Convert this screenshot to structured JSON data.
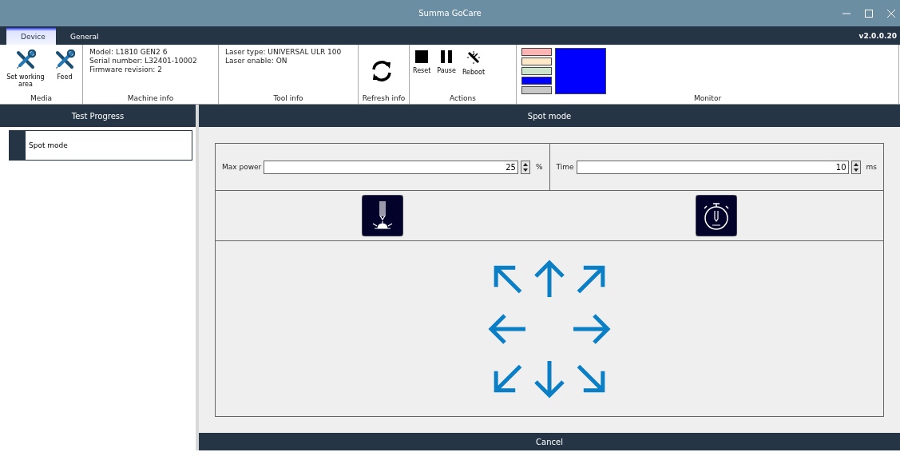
{
  "window": {
    "title": "Summa GoCare",
    "version": "v2.0.0.20"
  },
  "tabs": [
    {
      "label": "Device",
      "selected": true
    },
    {
      "label": "General",
      "selected": false
    }
  ],
  "ribbon": [
    {
      "kind": "buttons",
      "label": "Media",
      "buttons": [
        {
          "label": "Set working area",
          "kind": "tools"
        },
        {
          "label": "Feed",
          "kind": "tools"
        }
      ]
    },
    {
      "kind": "info",
      "label": "Machine info",
      "lines": [
        "Model: L1810 GEN2 6",
        "Serial number: L32401-10002",
        "Firmware revision: 2"
      ]
    },
    {
      "kind": "info",
      "label": "Tool info",
      "lines": [
        "Laser type: UNIVERSAL ULR 100",
        "Laser enable: ON"
      ]
    },
    {
      "kind": "buttons",
      "label": "Refresh info",
      "buttons": [
        {
          "kind": "refresh"
        }
      ]
    },
    {
      "kind": "buttons",
      "label": "Actions",
      "buttons": [
        {
          "label": "Reset",
          "kind": "stop"
        },
        {
          "label": "Pause",
          "kind": "pause"
        },
        {
          "label": "Reboot",
          "kind": "reboot"
        }
      ]
    },
    {
      "kind": "monitor",
      "label": "Monitor",
      "swatches": [
        {
          "color": "#ffb4b4"
        },
        {
          "color": "#ffe8c8"
        },
        {
          "color": "#cce6cc"
        },
        {
          "color": "#0000ff"
        },
        {
          "color": "#c8c8c8"
        }
      ],
      "display": {
        "color": "#0000ff"
      }
    }
  ],
  "test_progress": {
    "title": "Test Progress",
    "items": [
      {
        "label": "Spot mode",
        "selected": true
      }
    ]
  },
  "spot_mode": {
    "title": "Spot mode",
    "fields": [
      {
        "label": "Max power",
        "value": "25",
        "unit": "%"
      },
      {
        "label": "Time",
        "value": "10",
        "unit": "ms"
      }
    ],
    "cancel": "Cancel"
  }
}
